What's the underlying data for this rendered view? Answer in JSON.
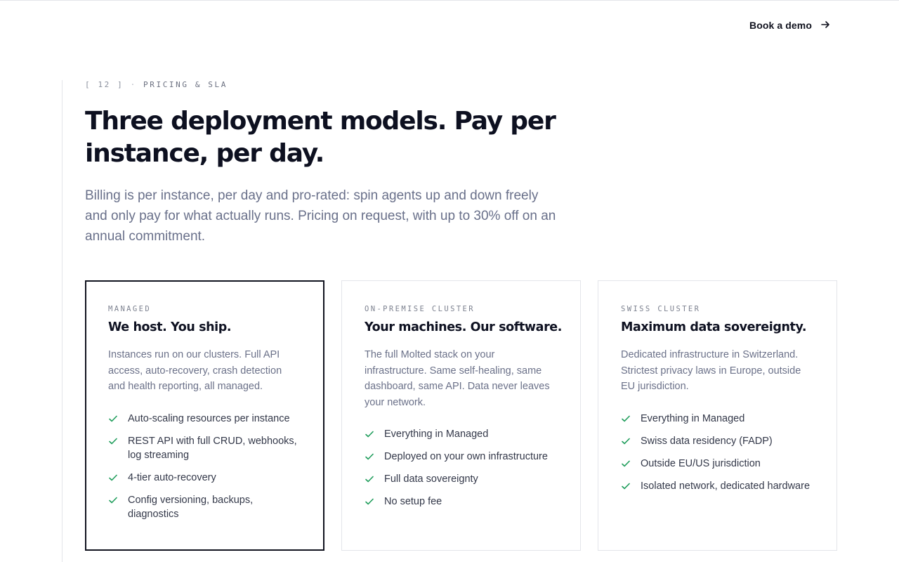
{
  "header": {
    "cta_label": "Book a demo",
    "cta_icon": "arrow-right-icon"
  },
  "section": {
    "index": "[ 12 ]",
    "separator": "·",
    "name": "PRICING & SLA",
    "headline": "Three deployment models. Pay per instance, per day.",
    "lead": "Billing is per instance, per day and pro-rated: spin agents up and down freely and only pay for what actually runs. Pricing on request, with up to 30% off on an annual commitment."
  },
  "colors": {
    "check": "#1f9d5b",
    "featured_border": "#11131f",
    "card_border": "#e3e5ea"
  },
  "plans": [
    {
      "label": "MANAGED",
      "title": "We host. You ship.",
      "description": "Instances run on our clusters. Full API access, auto-recovery, crash detection and health reporting, all managed.",
      "features": [
        "Auto-scaling resources per instance",
        "REST API with full CRUD, webhooks, log streaming",
        "4-tier auto-recovery",
        "Config versioning, backups, diagnostics"
      ]
    },
    {
      "label": "ON-PREMISE CLUSTER",
      "title": "Your machines. Our software.",
      "description": "The full Molted stack on your infrastructure. Same self-healing, same dashboard, same API. Data never leaves your network.",
      "features": [
        "Everything in Managed",
        "Deployed on your own infrastructure",
        "Full data sovereignty",
        "No setup fee"
      ]
    },
    {
      "label": "SWISS CLUSTER",
      "title": "Maximum data sovereignty.",
      "description": "Dedicated infrastructure in Switzerland. Strictest privacy laws in Europe, outside EU jurisdiction.",
      "features": [
        "Everything in Managed",
        "Swiss data residency (FADP)",
        "Outside EU/US jurisdiction",
        "Isolated network, dedicated hardware"
      ]
    }
  ]
}
